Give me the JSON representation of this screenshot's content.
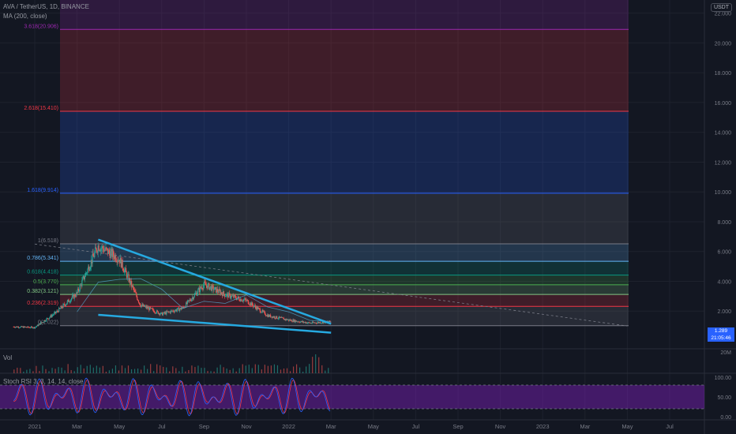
{
  "header": {
    "symbol_line": "AVA / TetherUS, 1D, BINANCE",
    "ma_line": "MA (200, close)",
    "currency": "USDT",
    "vol_label": "Vol",
    "stoch_label": "Stoch RSI 3, 3, 14, 14, close"
  },
  "price_tag": {
    "price": "1.289",
    "countdown": "21:05:46"
  },
  "colors": {
    "background": "#131722",
    "trendline": "#26a9e0",
    "stoch_k": "#2962ff",
    "stoch_d": "#f23645",
    "stoch_band": "#7e1fbf",
    "candle_up": "#26a69a",
    "candle_down": "#ef5350"
  },
  "chart_data": {
    "type": "candlestick",
    "price_axis": {
      "ticks": [
        "22.000",
        "20.000",
        "18.000",
        "16.000",
        "14.000",
        "12.000",
        "10.000",
        "8.000",
        "6.000",
        "4.000",
        "2.000"
      ],
      "ylim": [
        0,
        23.5
      ],
      "scale": "log"
    },
    "time_axis": {
      "ticks": [
        "2021",
        "Mar",
        "May",
        "Jul",
        "Sep",
        "Nov",
        "2022",
        "Mar",
        "May",
        "Jul",
        "Sep",
        "Nov",
        "2023",
        "Mar",
        "May",
        "Jul"
      ]
    },
    "volume_axis": {
      "ticks": [
        "20M"
      ]
    },
    "stoch_axis": {
      "ticks": [
        "100.00",
        "50.00",
        "0.00"
      ],
      "upper_band": 80,
      "lower_band": 20
    },
    "fibonacci": [
      {
        "label": "3.618(20.906)",
        "value": 20.906,
        "color": "#9c27b0"
      },
      {
        "label": "2.618(15.410)",
        "value": 15.41,
        "color": "#f23645"
      },
      {
        "label": "1.618(9.914)",
        "value": 9.914,
        "color": "#2962ff"
      },
      {
        "label": "1(6.518)",
        "value": 6.518,
        "color": "#787b86"
      },
      {
        "label": "0.786(5.341)",
        "value": 5.341,
        "color": "#64b5f6"
      },
      {
        "label": "0.618(4.418)",
        "value": 4.418,
        "color": "#089981"
      },
      {
        "label": "0.5(3.770)",
        "value": 3.77,
        "color": "#4caf50"
      },
      {
        "label": "0.382(3.121)",
        "value": 3.121,
        "color": "#81c784"
      },
      {
        "label": "0.236(2.319)",
        "value": 2.319,
        "color": "#f23645"
      },
      {
        "label": "0(1.022)",
        "value": 1.022,
        "color": "#787b86"
      }
    ],
    "trendlines": [
      {
        "name": "upper-wedge",
        "from": [
          "Apr 2021",
          6.8
        ],
        "to": [
          "Mar 2022",
          1.15
        ]
      },
      {
        "name": "lower-wedge",
        "from": [
          "Apr 2021",
          1.75
        ],
        "to": [
          "Mar 2022",
          0.55
        ]
      },
      {
        "name": "dashed-projection",
        "from": [
          "Jan 2021",
          6.5
        ],
        "to": [
          "May 2023",
          1.0
        ]
      }
    ],
    "price_path": [
      [
        "Dec 2020",
        0.95
      ],
      [
        "Jan 2021",
        0.9
      ],
      [
        "Feb 2021",
        1.9
      ],
      [
        "Mar 2021",
        3.2
      ],
      [
        "Apr 2021",
        6.4
      ],
      [
        "May 2021",
        5.5
      ],
      [
        "Jun 2021",
        2.4
      ],
      [
        "Jul 2021",
        1.8
      ],
      [
        "Aug 2021",
        2.2
      ],
      [
        "Sep 2021",
        3.8
      ],
      [
        "Oct 2021",
        3.1
      ],
      [
        "Nov 2021",
        2.7
      ],
      [
        "Dec 2021",
        1.7
      ],
      [
        "Jan 2022",
        1.4
      ],
      [
        "Feb 2022",
        1.2
      ],
      [
        "Mar 2022",
        1.289
      ]
    ]
  }
}
